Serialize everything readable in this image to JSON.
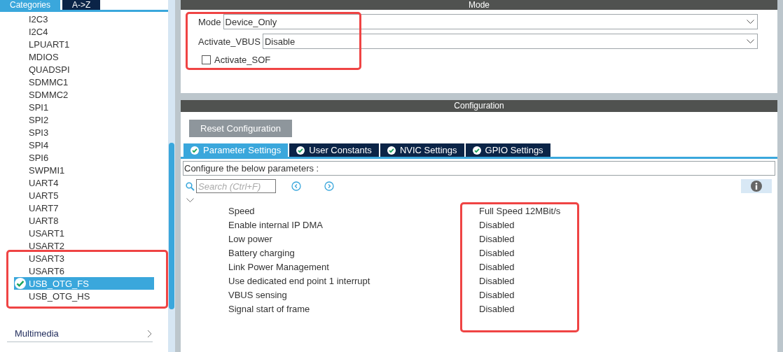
{
  "sidebar": {
    "tabs": [
      {
        "label": "Categories",
        "selected": true
      },
      {
        "label": "A->Z",
        "selected": false
      }
    ],
    "items": [
      {
        "label": "I2C3",
        "selected": false,
        "configured": false
      },
      {
        "label": "I2C4",
        "selected": false,
        "configured": false
      },
      {
        "label": "LPUART1",
        "selected": false,
        "configured": false
      },
      {
        "label": "MDIOS",
        "selected": false,
        "configured": false
      },
      {
        "label": "QUADSPI",
        "selected": false,
        "configured": false
      },
      {
        "label": "SDMMC1",
        "selected": false,
        "configured": false
      },
      {
        "label": "SDMMC2",
        "selected": false,
        "configured": false
      },
      {
        "label": "SPI1",
        "selected": false,
        "configured": false
      },
      {
        "label": "SPI2",
        "selected": false,
        "configured": false
      },
      {
        "label": "SPI3",
        "selected": false,
        "configured": false
      },
      {
        "label": "SPI4",
        "selected": false,
        "configured": false
      },
      {
        "label": "SPI6",
        "selected": false,
        "configured": false
      },
      {
        "label": "SWPMI1",
        "selected": false,
        "configured": false
      },
      {
        "label": "UART4",
        "selected": false,
        "configured": false
      },
      {
        "label": "UART5",
        "selected": false,
        "configured": false
      },
      {
        "label": "UART7",
        "selected": false,
        "configured": false
      },
      {
        "label": "UART8",
        "selected": false,
        "configured": false
      },
      {
        "label": "USART1",
        "selected": false,
        "configured": false
      },
      {
        "label": "USART2",
        "selected": false,
        "configured": false
      },
      {
        "label": "USART3",
        "selected": false,
        "configured": false
      },
      {
        "label": "USART6",
        "selected": false,
        "configured": false
      },
      {
        "label": "USB_OTG_FS",
        "selected": true,
        "configured": true
      },
      {
        "label": "USB_OTG_HS",
        "selected": false,
        "configured": false
      }
    ],
    "categories": [
      {
        "label": "Multimedia",
        "expanded": false
      }
    ]
  },
  "mode": {
    "title": "Mode",
    "fields": [
      {
        "label": "Mode",
        "value": "Device_Only"
      },
      {
        "label": "Activate_VBUS",
        "value": "Disable"
      }
    ],
    "checkbox": {
      "label": "Activate_SOF",
      "checked": false
    }
  },
  "configuration": {
    "title": "Configuration",
    "reset_button": "Reset Configuration",
    "tabs": [
      {
        "label": "Parameter Settings",
        "selected": true
      },
      {
        "label": "User Constants",
        "selected": false
      },
      {
        "label": "NVIC Settings",
        "selected": false
      },
      {
        "label": "GPIO Settings",
        "selected": false
      }
    ],
    "description": "Configure the below parameters :",
    "search": {
      "placeholder": "Search (Ctrl+F)"
    },
    "group": {
      "expanded": true,
      "parameters": [
        {
          "name": "Speed",
          "value": "Full Speed 12MBit/s"
        },
        {
          "name": "Enable internal IP DMA",
          "value": "Disabled"
        },
        {
          "name": "Low power",
          "value": "Disabled"
        },
        {
          "name": "Battery charging",
          "value": "Disabled"
        },
        {
          "name": "Link Power Management",
          "value": "Disabled"
        },
        {
          "name": "Use dedicated end point 1 interrupt",
          "value": "Disabled"
        },
        {
          "name": "VBUS sensing",
          "value": "Disabled"
        },
        {
          "name": "Signal start of frame",
          "value": "Disabled"
        }
      ]
    }
  }
}
